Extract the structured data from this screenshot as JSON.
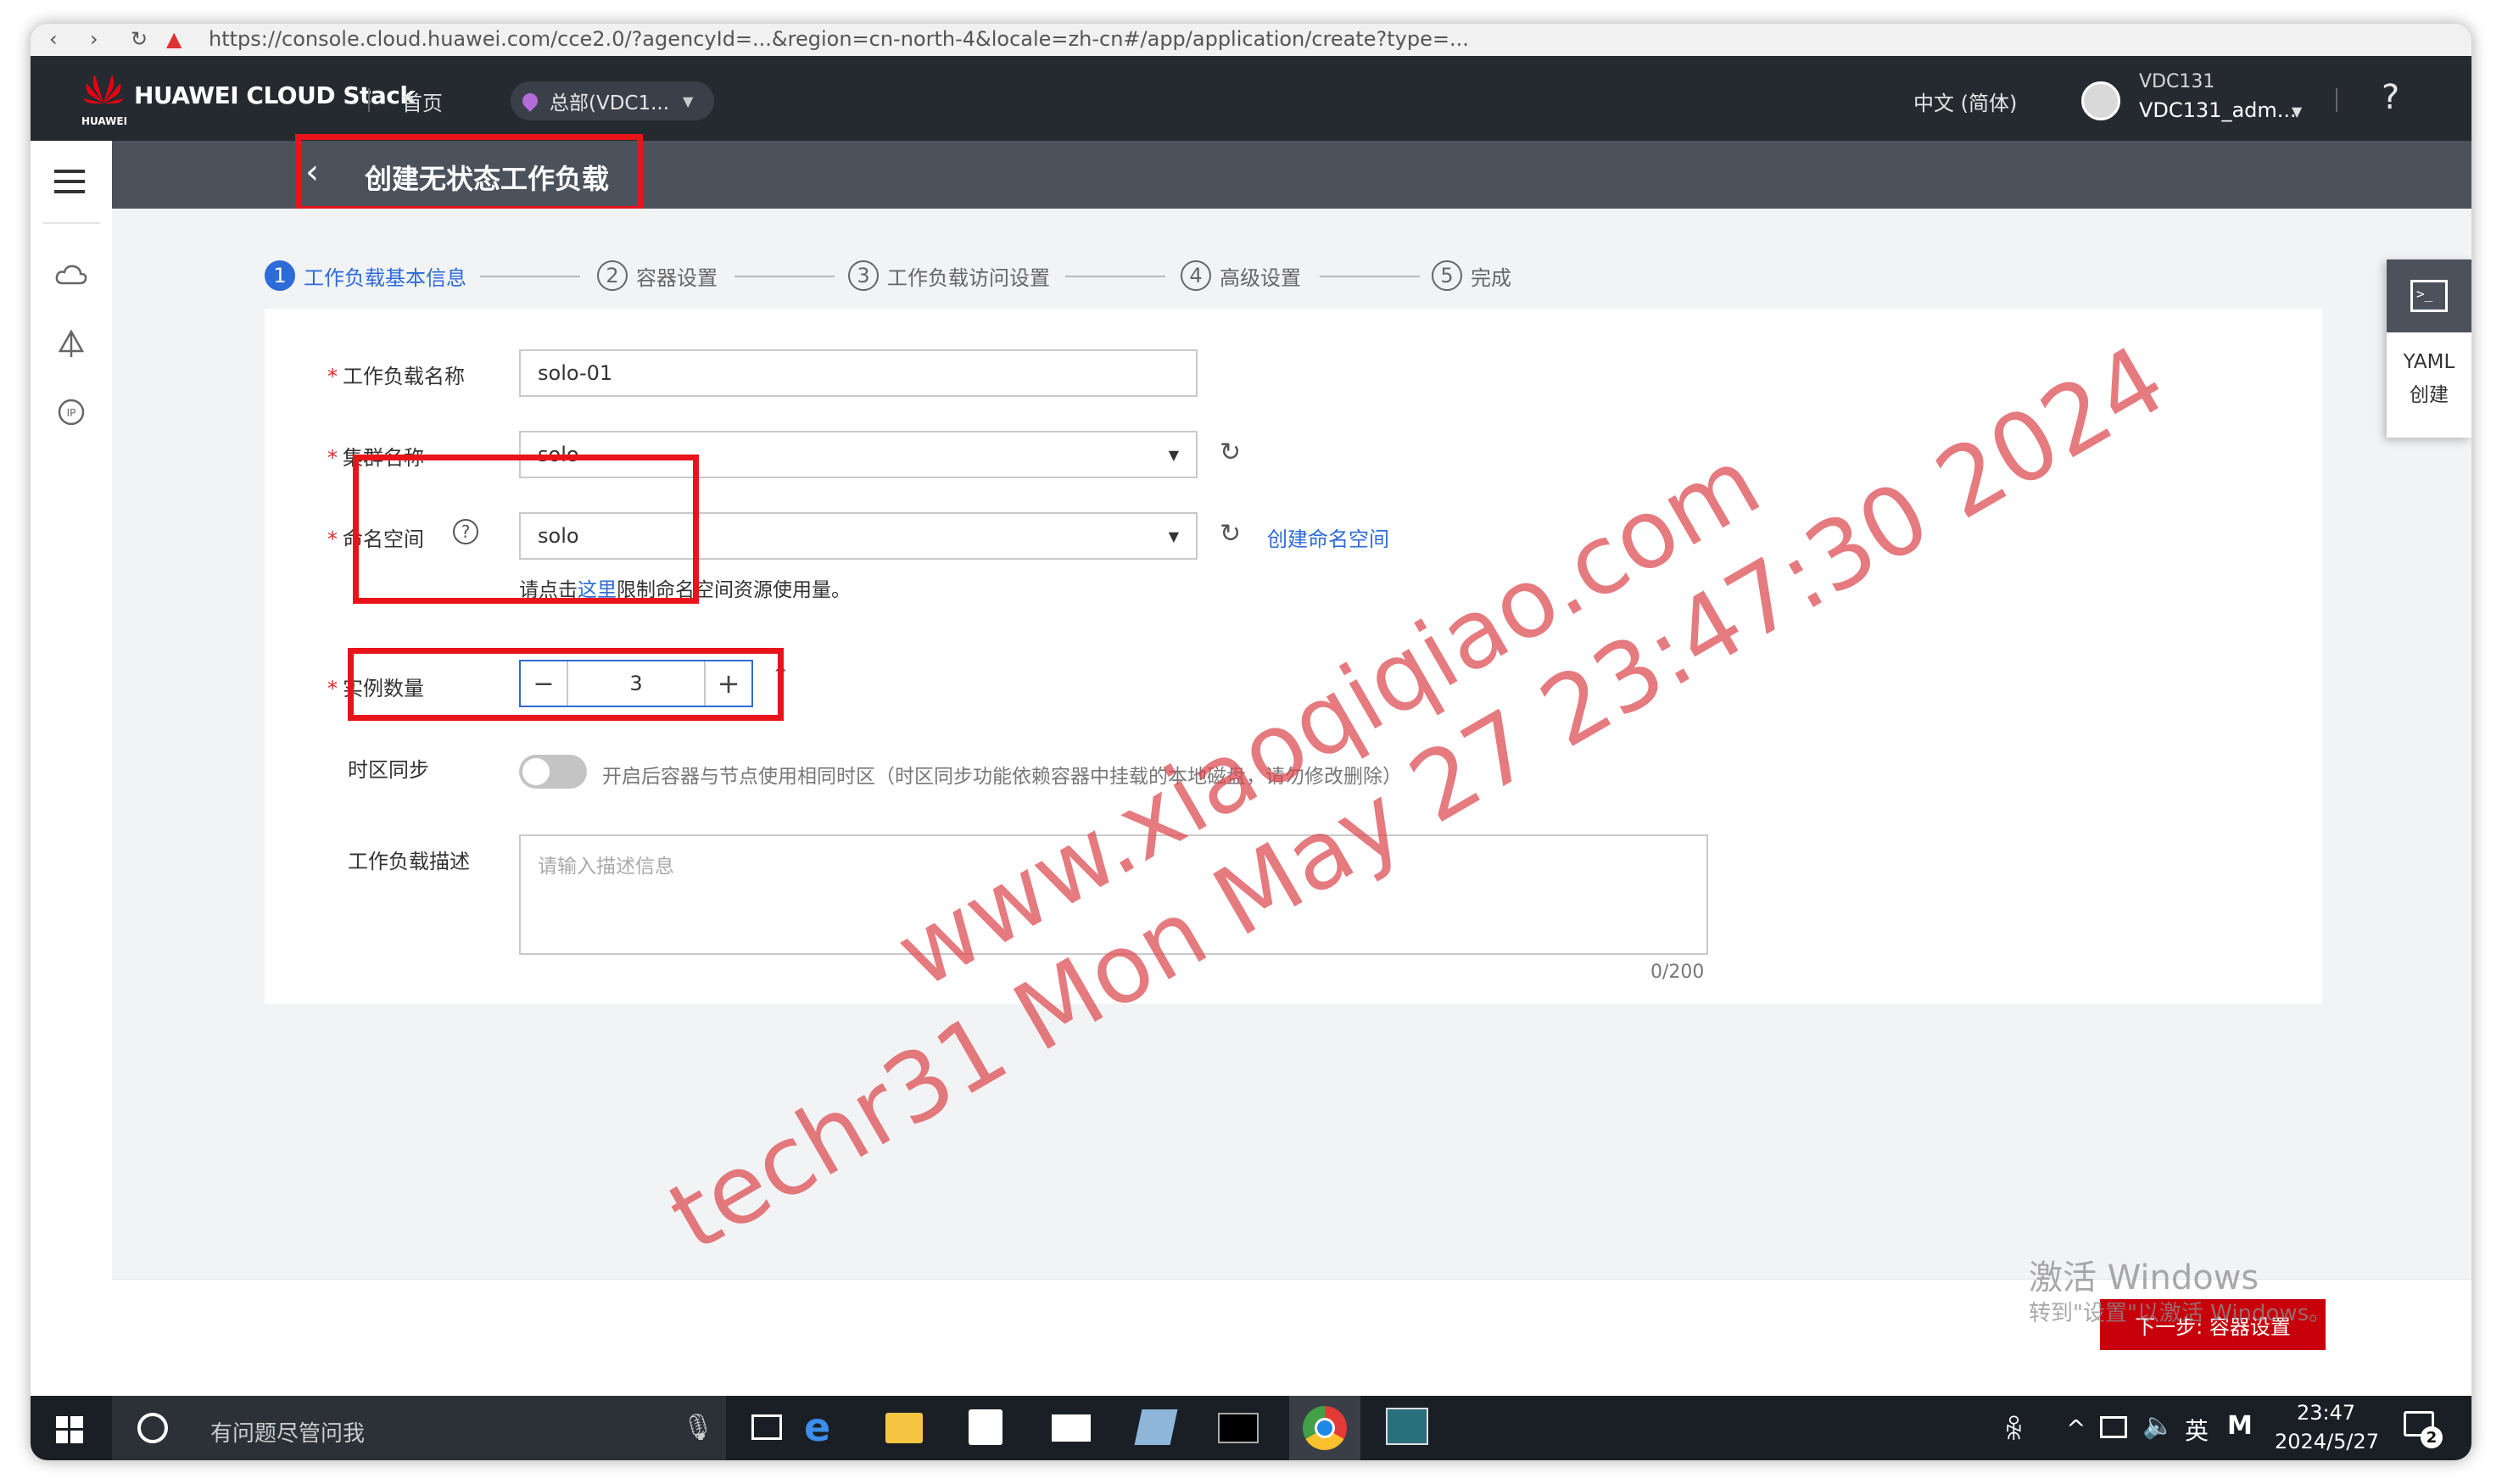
{
  "browser": {
    "url_fragment": "https://console.cloud.huawei.com/cce2.0/?agencyId=...&region=cn-north-4&locale=zh-cn#/app/application/create?type=..."
  },
  "topbar": {
    "brand": "HUAWEI CLOUD Stack",
    "logo_text": "HUAWEI",
    "home": "首页",
    "region": "总部(VDC1...",
    "language": "中文 (简体)",
    "vdc": "VDC131",
    "user": "VDC131_adm...",
    "help": "?"
  },
  "title": "创建无状态工作负载",
  "steps": [
    {
      "num": "1",
      "label": "工作负载基本信息"
    },
    {
      "num": "2",
      "label": "容器设置"
    },
    {
      "num": "3",
      "label": "工作负载访问设置"
    },
    {
      "num": "4",
      "label": "高级设置"
    },
    {
      "num": "5",
      "label": "完成"
    }
  ],
  "form": {
    "name": {
      "label": "工作负载名称",
      "value": "solo-01"
    },
    "cluster": {
      "label": "集群名称",
      "value": "solo"
    },
    "namespace": {
      "label": "命名空间",
      "value": "solo",
      "create_link": "创建命名空间"
    },
    "hint": {
      "prefix": "请点击",
      "link": "这里",
      "suffix": "限制命名空间资源使用量。"
    },
    "instances": {
      "label": "实例数量",
      "value": "3",
      "minus": "−",
      "plus": "+"
    },
    "timezone": {
      "label": "时区同步",
      "text": "开启后容器与节点使用相同时区（时区同步功能依赖容器中挂载的本地磁盘，请勿修改删除）"
    },
    "description": {
      "label": "工作负载描述",
      "placeholder": "请输入描述信息",
      "counter": "0/200"
    }
  },
  "yaml": {
    "line1": "YAML",
    "line2": "创建"
  },
  "footer": {
    "next": "下一步: 容器设置"
  },
  "activation": {
    "line1": "激活 Windows",
    "line2": "转到\"设置\"以激活 Windows。"
  },
  "watermark": {
    "line1": "www.xiaoqiqiao.com",
    "line2": "techr31 Mon May 27 23:47:30 2024"
  },
  "taskbar": {
    "search": "有问题尽管问我",
    "ime": "英",
    "time": "23:47",
    "date": "2024/5/27",
    "notif_count": "2"
  },
  "colors": {
    "accent": "#2e6bd8",
    "danger": "#e8141a",
    "next_button": "#c7000b"
  }
}
